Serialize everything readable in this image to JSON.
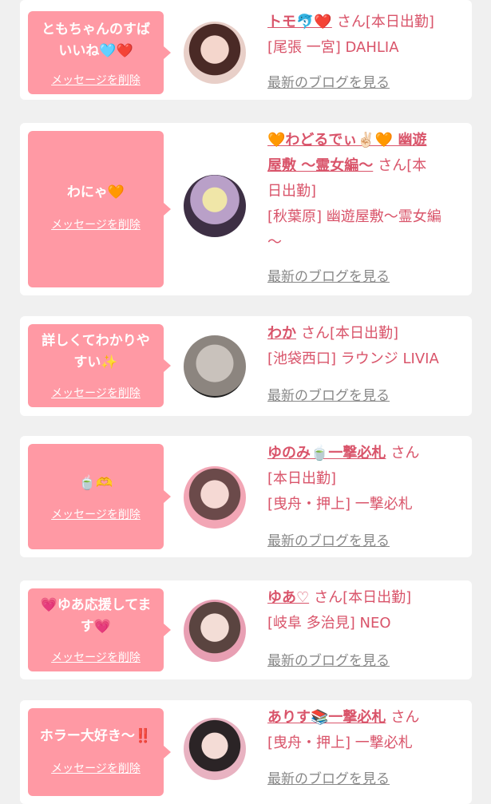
{
  "delete_label": "メッセージを削除",
  "blog_label": "最新のブログを見る",
  "san_label": "さん",
  "shift_label": "[本日出勤]",
  "cards": [
    {
      "message_line1": "ともちゃんのすば",
      "message_line2": "いいね🩵❤️",
      "name": "トモ🐬❤️",
      "store": "[尾張 一宮] DAHLIA"
    },
    {
      "message_line1": "わにゃ🧡",
      "message_line2": "",
      "name_line1": "🧡わどるでぃ✌🏻🧡 幽遊",
      "name_line2": "屋敷 〜霊女編〜",
      "store_line1": "[秋葉原] 幽遊屋敷〜霊女編",
      "store_line2": "〜",
      "shift_line1": "[本",
      "shift_line2": "日出勤]"
    },
    {
      "message_line1": "詳しくてわかりや",
      "message_line2": "すい✨",
      "name": "わか",
      "store": "[池袋西口] ラウンジ LIVIA"
    },
    {
      "message_line1": "🍵🫶",
      "message_line2": "",
      "name": "ゆのみ🍵一撃必札",
      "store": "[曳舟・押上] 一撃必札"
    },
    {
      "message_line1": "💗ゆあ応援してま",
      "message_line2": "す💗",
      "name": "ゆあ♡",
      "store": "[岐阜 多治見] NEO"
    },
    {
      "message_line1": "ホラー大好き〜‼️",
      "message_line2": "",
      "name": "ありす📚一撃必札",
      "store": "[曳舟・押上] 一撃必札"
    }
  ],
  "colors": {
    "bubble": "#ff99a4",
    "accent": "#d9546a",
    "card": "#ffffff",
    "background": "#f0f0f0"
  }
}
